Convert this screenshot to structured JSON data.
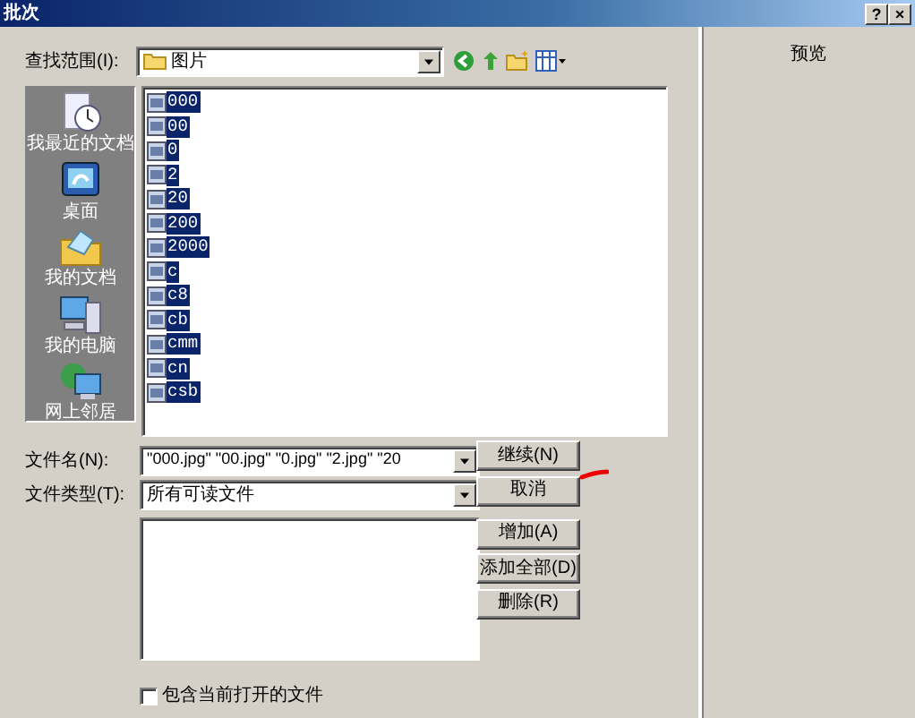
{
  "window": {
    "title": "批次",
    "title_buttons": [
      "?",
      "×"
    ]
  },
  "look_in": {
    "label": "查找范围(I):",
    "value": "图片"
  },
  "places": [
    {
      "label": "我最近的文档"
    },
    {
      "label": "桌面"
    },
    {
      "label": "我的文档"
    },
    {
      "label": "我的电脑"
    },
    {
      "label": "网上邻居"
    }
  ],
  "files": [
    {
      "name": "000",
      "selected": true
    },
    {
      "name": "00",
      "selected": true
    },
    {
      "name": "0",
      "selected": true
    },
    {
      "name": "2",
      "selected": true
    },
    {
      "name": "20",
      "selected": true
    },
    {
      "name": "200",
      "selected": true
    },
    {
      "name": "2000",
      "selected": true
    },
    {
      "name": "c",
      "selected": true
    },
    {
      "name": "c8",
      "selected": true
    },
    {
      "name": "cb",
      "selected": true
    },
    {
      "name": "cmm",
      "selected": true
    },
    {
      "name": "cn",
      "selected": true
    },
    {
      "name": "csb",
      "selected": true
    }
  ],
  "file_name": {
    "label": "文件名(N):",
    "value": "\"000.jpg\" \"00.jpg\" \"0.jpg\" \"2.jpg\" \"20"
  },
  "file_type": {
    "label": "文件类型(T):",
    "value": "所有可读文件"
  },
  "buttons": [
    "继续(N)",
    "取消"
  ],
  "list_buttons": [
    "增加(A)",
    "添加全部(D)",
    "删除(R)"
  ],
  "include_open": {
    "label": "包含当前打开的文件",
    "checked": false
  },
  "preview": {
    "label": "预览"
  }
}
